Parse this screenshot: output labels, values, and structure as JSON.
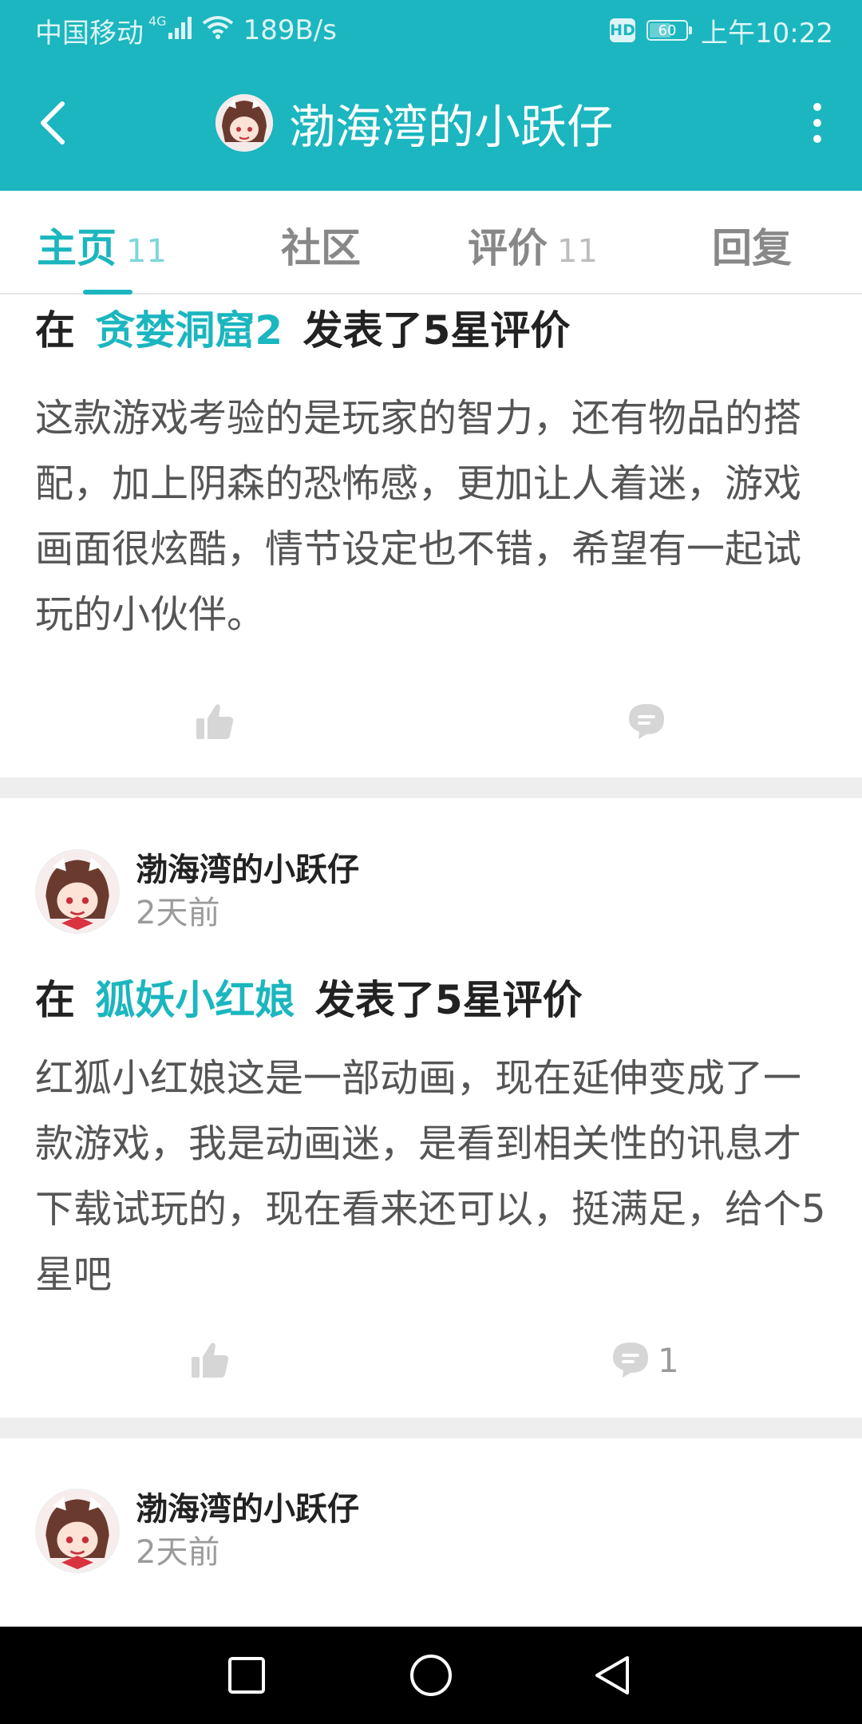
{
  "status_bar": {
    "carrier": "中国移动",
    "network": "4G",
    "speed": "189B/s",
    "hd": "HD",
    "battery": "60",
    "battery_level": 0.6,
    "time": "上午10:22"
  },
  "app_bar": {
    "title": "渤海湾的小跃仔",
    "back_icon": "back-arrow-icon",
    "more_icon": "more-vertical-icon"
  },
  "tabs": [
    {
      "label": "主页",
      "count": "11",
      "active": true
    },
    {
      "label": "社区",
      "count": "",
      "active": false
    },
    {
      "label": "评价",
      "count": "11",
      "active": false
    },
    {
      "label": "回复",
      "count": "",
      "active": false
    }
  ],
  "posts": [
    {
      "action_prefix": "在",
      "game": "贪婪洞窟2",
      "action_suffix": "发表了5星评价",
      "text": "这款游戏考验的是玩家的智力，还有物品的搭配，加上阴森的恐怖感，更加让人着迷，游戏画面很炫酷，情节设定也不错，希望有一起试玩的小伙伴。",
      "comment_count": ""
    },
    {
      "user": "渤海湾的小跃仔",
      "time": "2天前",
      "action_prefix": "在",
      "game": "狐妖小红娘",
      "action_suffix": "发表了5星评价",
      "text": "红狐小红娘这是一部动画，现在延伸变成了一款游戏，我是动画迷，是看到相关性的讯息才下载试玩的，现在看来还可以，挺满足，给个5星吧",
      "comment_count": "1"
    },
    {
      "user": "渤海湾的小跃仔",
      "time": "2天前"
    }
  ],
  "colors": {
    "accent": "#1bb6bf",
    "text_dark": "#222222",
    "text_body": "#555555",
    "text_muted": "#9b9b9b",
    "separator": "#eeeeee"
  },
  "nav_bar": {
    "recent_icon": "square-recent-apps-icon",
    "home_icon": "circle-home-icon",
    "back_icon": "triangle-back-icon"
  }
}
